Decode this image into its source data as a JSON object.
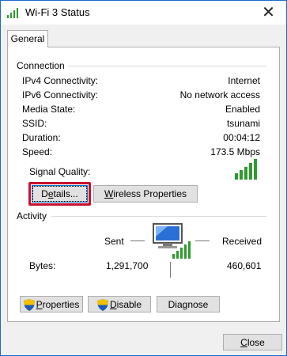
{
  "window": {
    "title": "Wi-Fi 3 Status",
    "close_glyph": "✕"
  },
  "tabs": [
    {
      "label": "General"
    }
  ],
  "connection": {
    "section_label": "Connection",
    "rows": [
      {
        "key": "IPv4 Connectivity:",
        "value": "Internet"
      },
      {
        "key": "IPv6 Connectivity:",
        "value": "No network access"
      },
      {
        "key": "Media State:",
        "value": "Enabled"
      },
      {
        "key": "SSID:",
        "value": "tsunami"
      },
      {
        "key": "Duration:",
        "value": "00:04:12"
      },
      {
        "key": "Speed:",
        "value": "173.5 Mbps"
      }
    ],
    "signal_label": "Signal Quality:",
    "signal_bars": 5,
    "signal_color": "#2e9b2e"
  },
  "buttons": {
    "details_prefix": "D",
    "details_underline": "e",
    "details_rest": "tails...",
    "wireless_underline": "W",
    "wireless_rest": "ireless Properties",
    "properties_underline": "P",
    "properties_rest": "roperties",
    "disable_underline": "D",
    "disable_rest": "isable",
    "diagnose": "Diagnose",
    "close_underline": "C",
    "close_rest": "lose"
  },
  "activity": {
    "section_label": "Activity",
    "sent_label": "Sent",
    "received_label": "Received",
    "bytes_label": "Bytes:",
    "bytes_sent": "1,291,700",
    "bytes_received": "460,601"
  },
  "colors": {
    "accent": "#0078d7",
    "highlight": "#c8102e",
    "shield_blue": "#1e5bb8",
    "shield_yellow": "#f2c200"
  }
}
